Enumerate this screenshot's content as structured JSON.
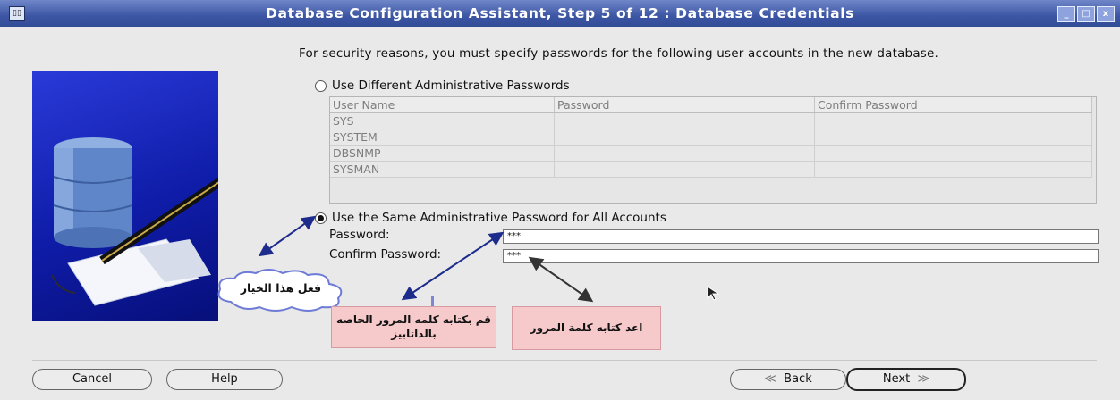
{
  "window": {
    "title": "Database Configuration Assistant, Step 5 of 12 : Database Credentials",
    "controls": [
      "_",
      "□",
      "x"
    ]
  },
  "intro_text": "For security reasons, you must specify passwords for the following user accounts in the new database.",
  "options": {
    "different": {
      "label": "Use Different Administrative Passwords",
      "selected": false
    },
    "same": {
      "label": "Use the Same Administrative Password for All Accounts",
      "selected": true
    }
  },
  "accounts_table": {
    "headers": [
      "User Name",
      "Password",
      "Confirm Password"
    ],
    "rows": [
      [
        "SYS",
        "",
        ""
      ],
      [
        "SYSTEM",
        "",
        ""
      ],
      [
        "DBSNMP",
        "",
        ""
      ],
      [
        "SYSMAN",
        "",
        ""
      ]
    ]
  },
  "fields": {
    "password": {
      "label": "Password:",
      "value": "***"
    },
    "confirm": {
      "label": "Confirm Password:",
      "value": "***"
    }
  },
  "annotations": {
    "cloud": "فعل هذا الخيار",
    "enter_password": "قم بكتابه كلمه المرور الخاصه بالداتابيز",
    "reenter_password": "اعد كتابه كلمة المرور"
  },
  "buttons": {
    "cancel": "Cancel",
    "help": "Help",
    "back": "Back",
    "next": "Next"
  }
}
